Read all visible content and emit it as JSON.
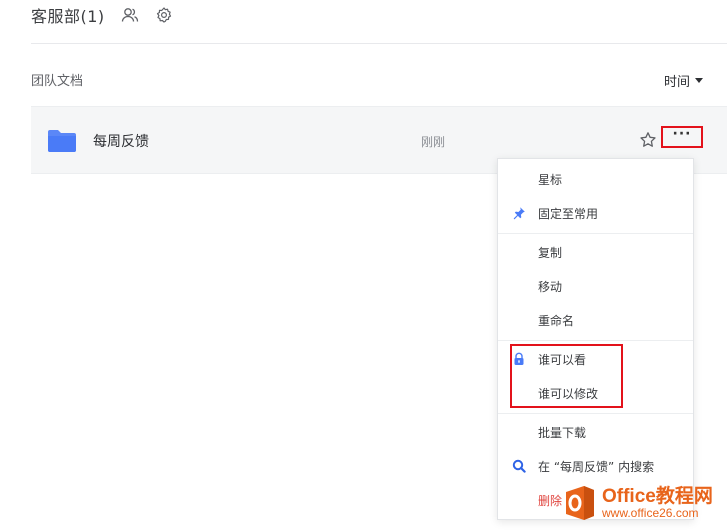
{
  "header": {
    "title": "客服部(1)",
    "icons": [
      "members-icon",
      "settings-icon"
    ]
  },
  "section": {
    "label": "团队文档",
    "sort_label": "时间"
  },
  "file_row": {
    "name": "每周反馈",
    "time": "刚刚",
    "more_label": "···"
  },
  "menu": {
    "items": [
      {
        "label": "星标",
        "icon": ""
      },
      {
        "label": "固定至常用",
        "icon": "pin-icon"
      },
      {
        "label": "复制",
        "icon": ""
      },
      {
        "label": "移动",
        "icon": ""
      },
      {
        "label": "重命名",
        "icon": ""
      },
      {
        "label": "谁可以看",
        "icon": "lock-icon"
      },
      {
        "label": "谁可以修改",
        "icon": ""
      },
      {
        "label": "批量下载",
        "icon": ""
      },
      {
        "label": "在 “每周反馈” 内搜索",
        "icon": "search-icon"
      },
      {
        "label": "删除",
        "icon": ""
      }
    ]
  },
  "watermark": {
    "brand": "Office教程网",
    "url": "www.office26.com"
  },
  "colors": {
    "accent": "#4a7bf7",
    "highlight": "#e3121b",
    "danger": "#e0443e",
    "watermark": "#e8641b"
  }
}
